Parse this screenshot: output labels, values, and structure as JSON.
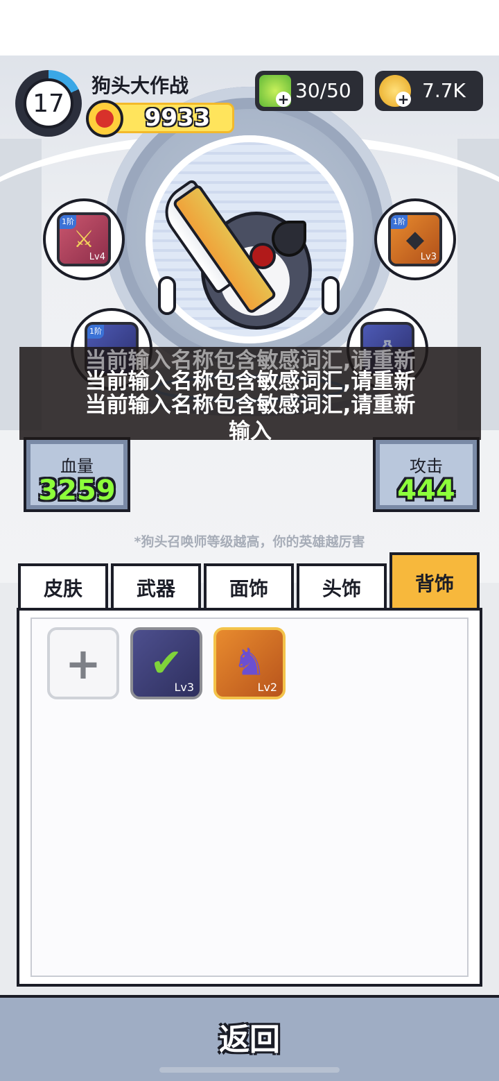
{
  "header": {
    "player_level": "17",
    "player_name": "狗头大作战",
    "power": "9933",
    "energy": "30/50",
    "coins": "7.7K",
    "level_progress": 0.18
  },
  "equipped": {
    "weapon": {
      "tier": "1阶",
      "level": "Lv4"
    },
    "head": {
      "tier": "1阶",
      "level": "Lv3"
    },
    "lower_left": {
      "tier": "1阶"
    }
  },
  "stats": {
    "hp_label": "血量",
    "hp_value": "3259",
    "attack_label": "攻击",
    "attack_value": "444"
  },
  "toast": {
    "line1": "当前输入名称包含敏感词汇,请重新",
    "line2": "当前输入名称包含敏感词汇,请重新",
    "line3": "当前输入名称包含敏感词汇,请重新",
    "line4": "输入"
  },
  "hint": "*狗头召唤师等级越高，你的英雄越厉害",
  "tabs": [
    {
      "label": "皮肤"
    },
    {
      "label": "武器"
    },
    {
      "label": "面饰"
    },
    {
      "label": "头饰"
    },
    {
      "label": "背饰"
    }
  ],
  "active_tab": "背饰",
  "inventory": [
    {
      "icon": "check-icon",
      "level": "Lv3"
    },
    {
      "icon": "hood-icon",
      "level": "Lv2"
    }
  ],
  "back_label": "返回",
  "colors": {
    "active_tab": "#f7b83c",
    "stat_value": "#8dff3b",
    "resource_pill": "#2b2d35"
  }
}
